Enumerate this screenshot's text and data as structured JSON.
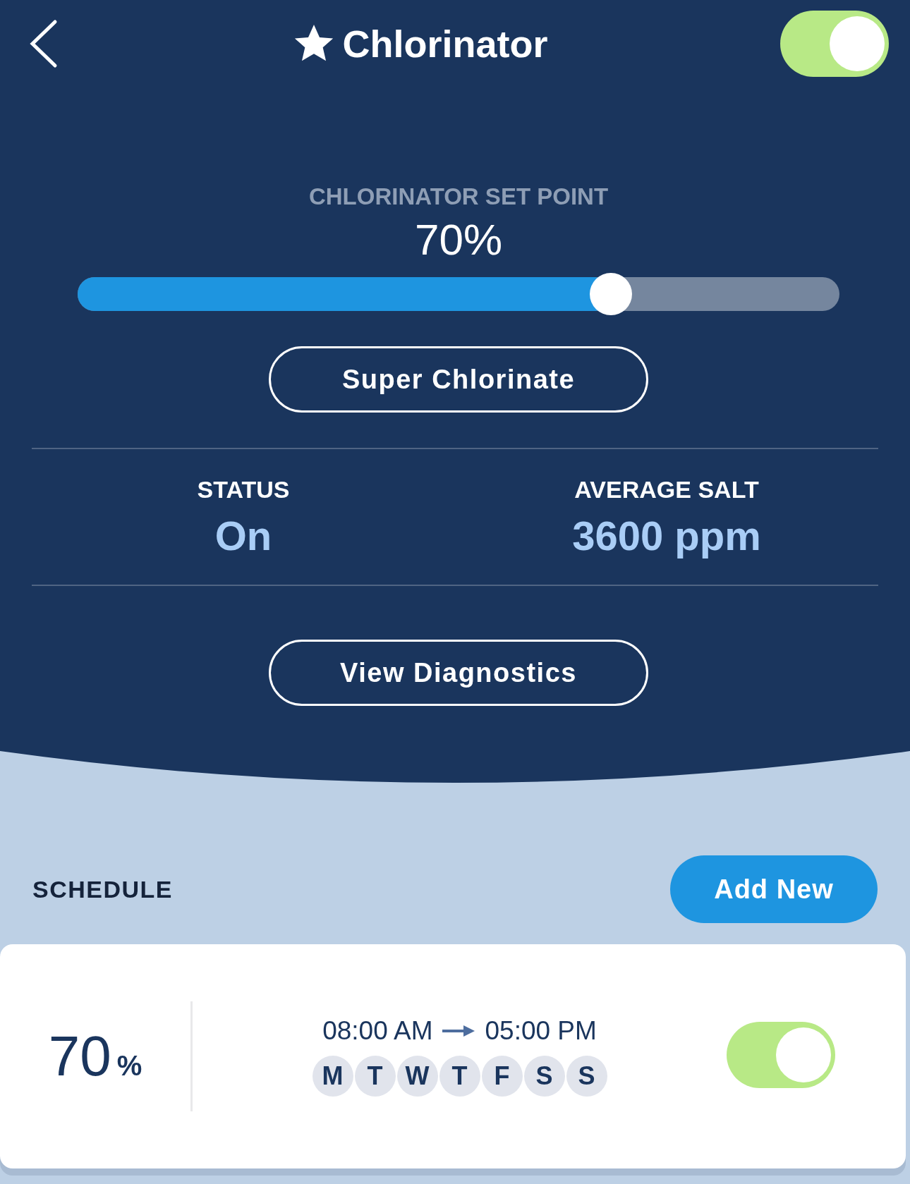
{
  "header": {
    "title": "Chlorinator",
    "favorite": true,
    "power_on": true
  },
  "set_point": {
    "label": "CHLORINATOR SET POINT",
    "reading": "70%",
    "level": 0.7
  },
  "super_chlorinate_button": "Super Chlorinate",
  "stats": [
    {
      "label": "STATUS",
      "value": "On"
    },
    {
      "label": "AVERAGE SALT",
      "value": "3600 ppm"
    }
  ],
  "diagnostics_button": "View Diagnostics",
  "schedule": {
    "title": "SCHEDULE",
    "add_button": "Add New",
    "entries": [
      {
        "value": "70",
        "unit": "%",
        "start": "08:00 AM",
        "end": "05:00 PM",
        "on": true,
        "days": [
          {
            "label": "M",
            "selected": true
          },
          {
            "label": "T",
            "selected": true
          },
          {
            "label": "W",
            "selected": true
          },
          {
            "label": "T",
            "selected": true
          },
          {
            "label": "F",
            "selected": true
          },
          {
            "label": "S",
            "selected": true
          },
          {
            "label": "S",
            "selected": true
          }
        ]
      }
    ]
  }
}
